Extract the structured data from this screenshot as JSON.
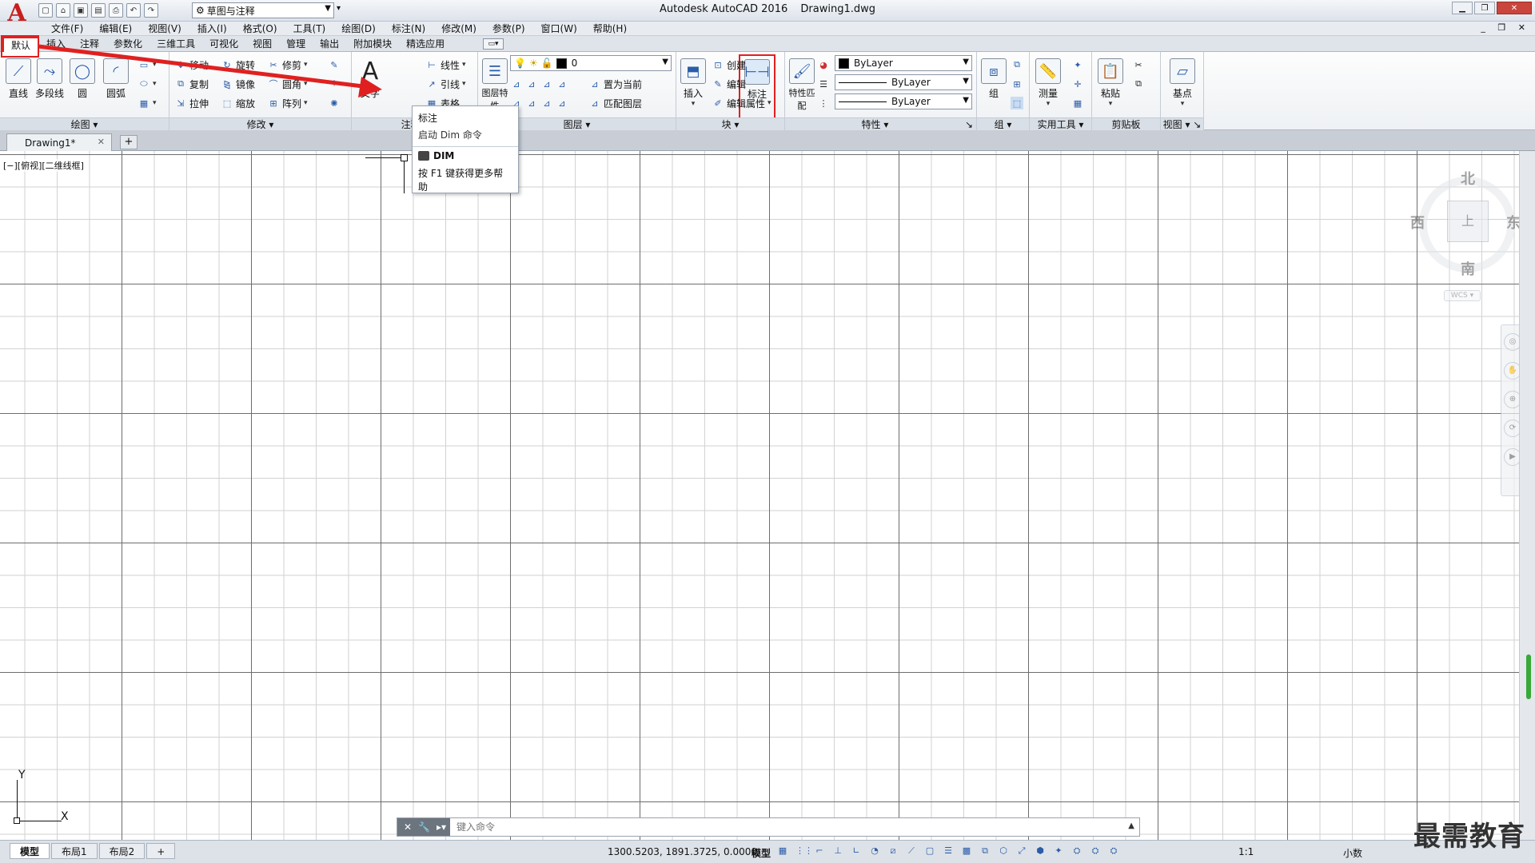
{
  "title_bar": {
    "app_name": "Autodesk AutoCAD 2016",
    "document": "Drawing1.dwg",
    "workspace": "草图与注释"
  },
  "menu_bar": {
    "items": [
      "文件(F)",
      "编辑(E)",
      "视图(V)",
      "插入(I)",
      "格式(O)",
      "工具(T)",
      "绘图(D)",
      "标注(N)",
      "修改(M)",
      "参数(P)",
      "窗口(W)",
      "帮助(H)"
    ]
  },
  "ribbon_tabs": [
    "默认",
    "插入",
    "注释",
    "参数化",
    "三维工具",
    "可视化",
    "视图",
    "管理",
    "输出",
    "附加模块",
    "精选应用"
  ],
  "ribbon": {
    "draw": {
      "title": "绘图",
      "tools": [
        "直线",
        "多段线",
        "圆",
        "圆弧"
      ]
    },
    "modify": {
      "title": "修改",
      "tools": [
        "移动",
        "旋转",
        "修剪",
        "复制",
        "镜像",
        "圆角",
        "拉伸",
        "缩放",
        "阵列"
      ]
    },
    "annotation": {
      "title": "注释",
      "text": "文字",
      "dim": "标注",
      "linear": "线性",
      "leader": "引线",
      "table": "表格"
    },
    "layers": {
      "title": "图层",
      "layer_props": "图层特性",
      "current_layer": "0",
      "set_current": "置为当前",
      "match_layer": "匹配图层"
    },
    "block": {
      "title": "块",
      "insert": "插入",
      "create": "创建",
      "edit": "编辑",
      "edit_attr": "编辑属性"
    },
    "properties": {
      "title": "特性",
      "match": "特性匹配",
      "color": "ByLayer",
      "linetype": "ByLayer",
      "lineweight": "ByLayer"
    },
    "groups": {
      "title": "组",
      "group": "组"
    },
    "utilities": {
      "title": "实用工具",
      "measure": "测量"
    },
    "clipboard": {
      "title": "剪贴板",
      "paste": "粘贴"
    },
    "view": {
      "title": "视图",
      "base": "基点"
    }
  },
  "tooltip": {
    "title": "标注",
    "description": "启动 Dim 命令",
    "command": "DIM",
    "help": "按 F1 键获得更多帮助"
  },
  "file_tab": {
    "name": "Drawing1*"
  },
  "viewport_label": "[−][俯视][二维线框]",
  "viewcube": {
    "north": "北",
    "south": "南",
    "east": "东",
    "west": "西",
    "wcs": "WCS"
  },
  "ucs": {
    "x": "X",
    "y": "Y"
  },
  "command_line": {
    "placeholder": "键入命令"
  },
  "status_bar": {
    "layouts": [
      "模型",
      "布局1",
      "布局2"
    ],
    "coords": "1300.5203, 1891.3725, 0.0000",
    "space": "模型",
    "scale": "1:1",
    "units": "小数"
  },
  "watermark": "最需教育",
  "colors": {
    "accent_red": "#e02020",
    "grid_major": "#6d6d6d",
    "grid_minor": "#d2d2d2"
  }
}
